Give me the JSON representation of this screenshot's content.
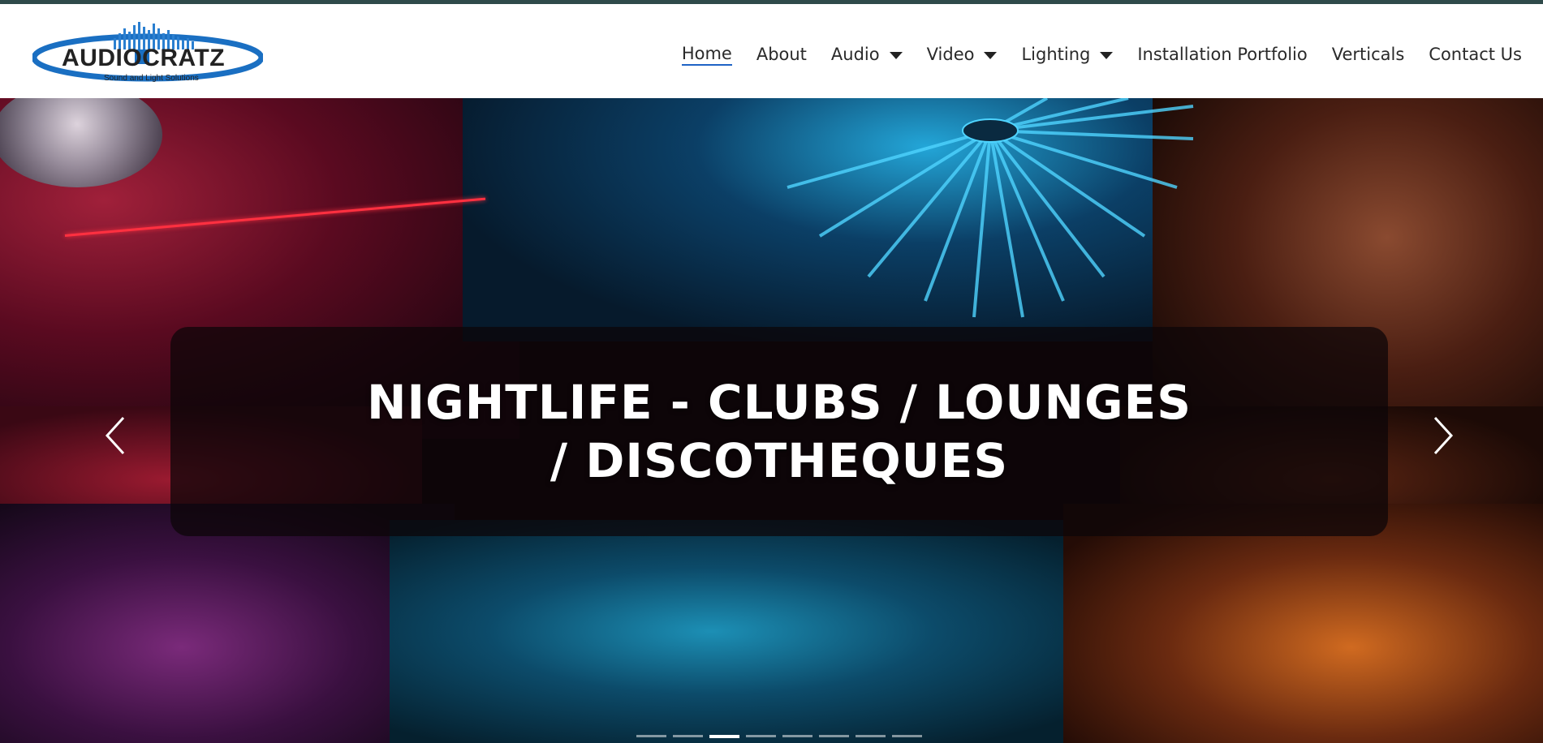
{
  "logo": {
    "name": "AUDIOCRATZ",
    "tagline": "Sound and Light Solutions"
  },
  "nav": {
    "items": [
      {
        "label": "Home",
        "active": true,
        "dropdown": false
      },
      {
        "label": "About",
        "active": false,
        "dropdown": false
      },
      {
        "label": "Audio",
        "active": false,
        "dropdown": true
      },
      {
        "label": "Video",
        "active": false,
        "dropdown": true
      },
      {
        "label": "Lighting",
        "active": false,
        "dropdown": true
      },
      {
        "label": "Installation Portfolio",
        "active": false,
        "dropdown": false
      },
      {
        "label": "Verticals",
        "active": false,
        "dropdown": false
      },
      {
        "label": "Contact Us",
        "active": false,
        "dropdown": false
      }
    ]
  },
  "hero": {
    "title": "NIGHTLIFE - CLUBS / LOUNGES / DISCOTHEQUES",
    "prev_icon": "chevron-left-icon",
    "next_icon": "chevron-right-icon",
    "slide_count": 8,
    "active_slide": 3
  },
  "colors": {
    "top_bar": "#2f4a4a",
    "active_underline": "#1f63c6",
    "logo_blue": "#1a6fc2",
    "caption_bg": "rgba(12,6,8,0.74)"
  }
}
